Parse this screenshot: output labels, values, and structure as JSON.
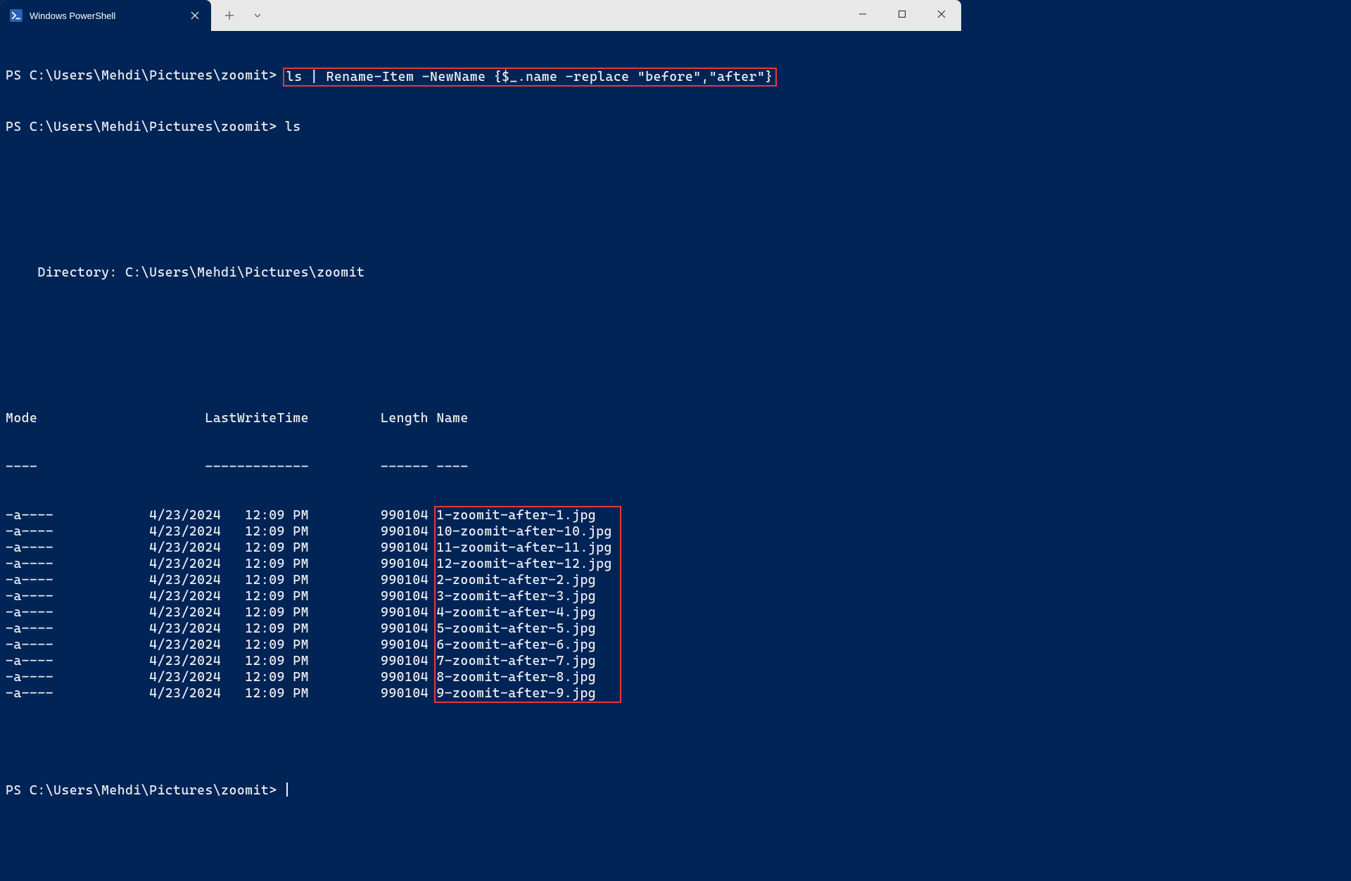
{
  "tab": {
    "title": "Windows PowerShell"
  },
  "terminal": {
    "prompt": "PS C:\\Users\\Mehdi\\Pictures\\zoomit>",
    "command1": "ls | Rename-Item -NewName {$_.name -replace \"before\",\"after\"}",
    "command2": "ls",
    "directoryLabel": "    Directory: C:\\Users\\Mehdi\\Pictures\\zoomit",
    "headers": {
      "mode": "Mode",
      "lastWriteTime": "LastWriteTime",
      "length": "Length",
      "name": "Name"
    },
    "dividers": {
      "mode": "----",
      "lastWriteTime": "-------------",
      "length": "------",
      "name": "----"
    },
    "rows": [
      {
        "mode": "-a----",
        "date": "4/23/2024",
        "time": "12:09 PM",
        "length": "990104",
        "name": "1-zoomit-after-1.jpg"
      },
      {
        "mode": "-a----",
        "date": "4/23/2024",
        "time": "12:09 PM",
        "length": "990104",
        "name": "10-zoomit-after-10.jpg"
      },
      {
        "mode": "-a----",
        "date": "4/23/2024",
        "time": "12:09 PM",
        "length": "990104",
        "name": "11-zoomit-after-11.jpg"
      },
      {
        "mode": "-a----",
        "date": "4/23/2024",
        "time": "12:09 PM",
        "length": "990104",
        "name": "12-zoomit-after-12.jpg"
      },
      {
        "mode": "-a----",
        "date": "4/23/2024",
        "time": "12:09 PM",
        "length": "990104",
        "name": "2-zoomit-after-2.jpg"
      },
      {
        "mode": "-a----",
        "date": "4/23/2024",
        "time": "12:09 PM",
        "length": "990104",
        "name": "3-zoomit-after-3.jpg"
      },
      {
        "mode": "-a----",
        "date": "4/23/2024",
        "time": "12:09 PM",
        "length": "990104",
        "name": "4-zoomit-after-4.jpg"
      },
      {
        "mode": "-a----",
        "date": "4/23/2024",
        "time": "12:09 PM",
        "length": "990104",
        "name": "5-zoomit-after-5.jpg"
      },
      {
        "mode": "-a----",
        "date": "4/23/2024",
        "time": "12:09 PM",
        "length": "990104",
        "name": "6-zoomit-after-6.jpg"
      },
      {
        "mode": "-a----",
        "date": "4/23/2024",
        "time": "12:09 PM",
        "length": "990104",
        "name": "7-zoomit-after-7.jpg"
      },
      {
        "mode": "-a----",
        "date": "4/23/2024",
        "time": "12:09 PM",
        "length": "990104",
        "name": "8-zoomit-after-8.jpg"
      },
      {
        "mode": "-a----",
        "date": "4/23/2024",
        "time": "12:09 PM",
        "length": "990104",
        "name": "9-zoomit-after-9.jpg"
      }
    ]
  }
}
